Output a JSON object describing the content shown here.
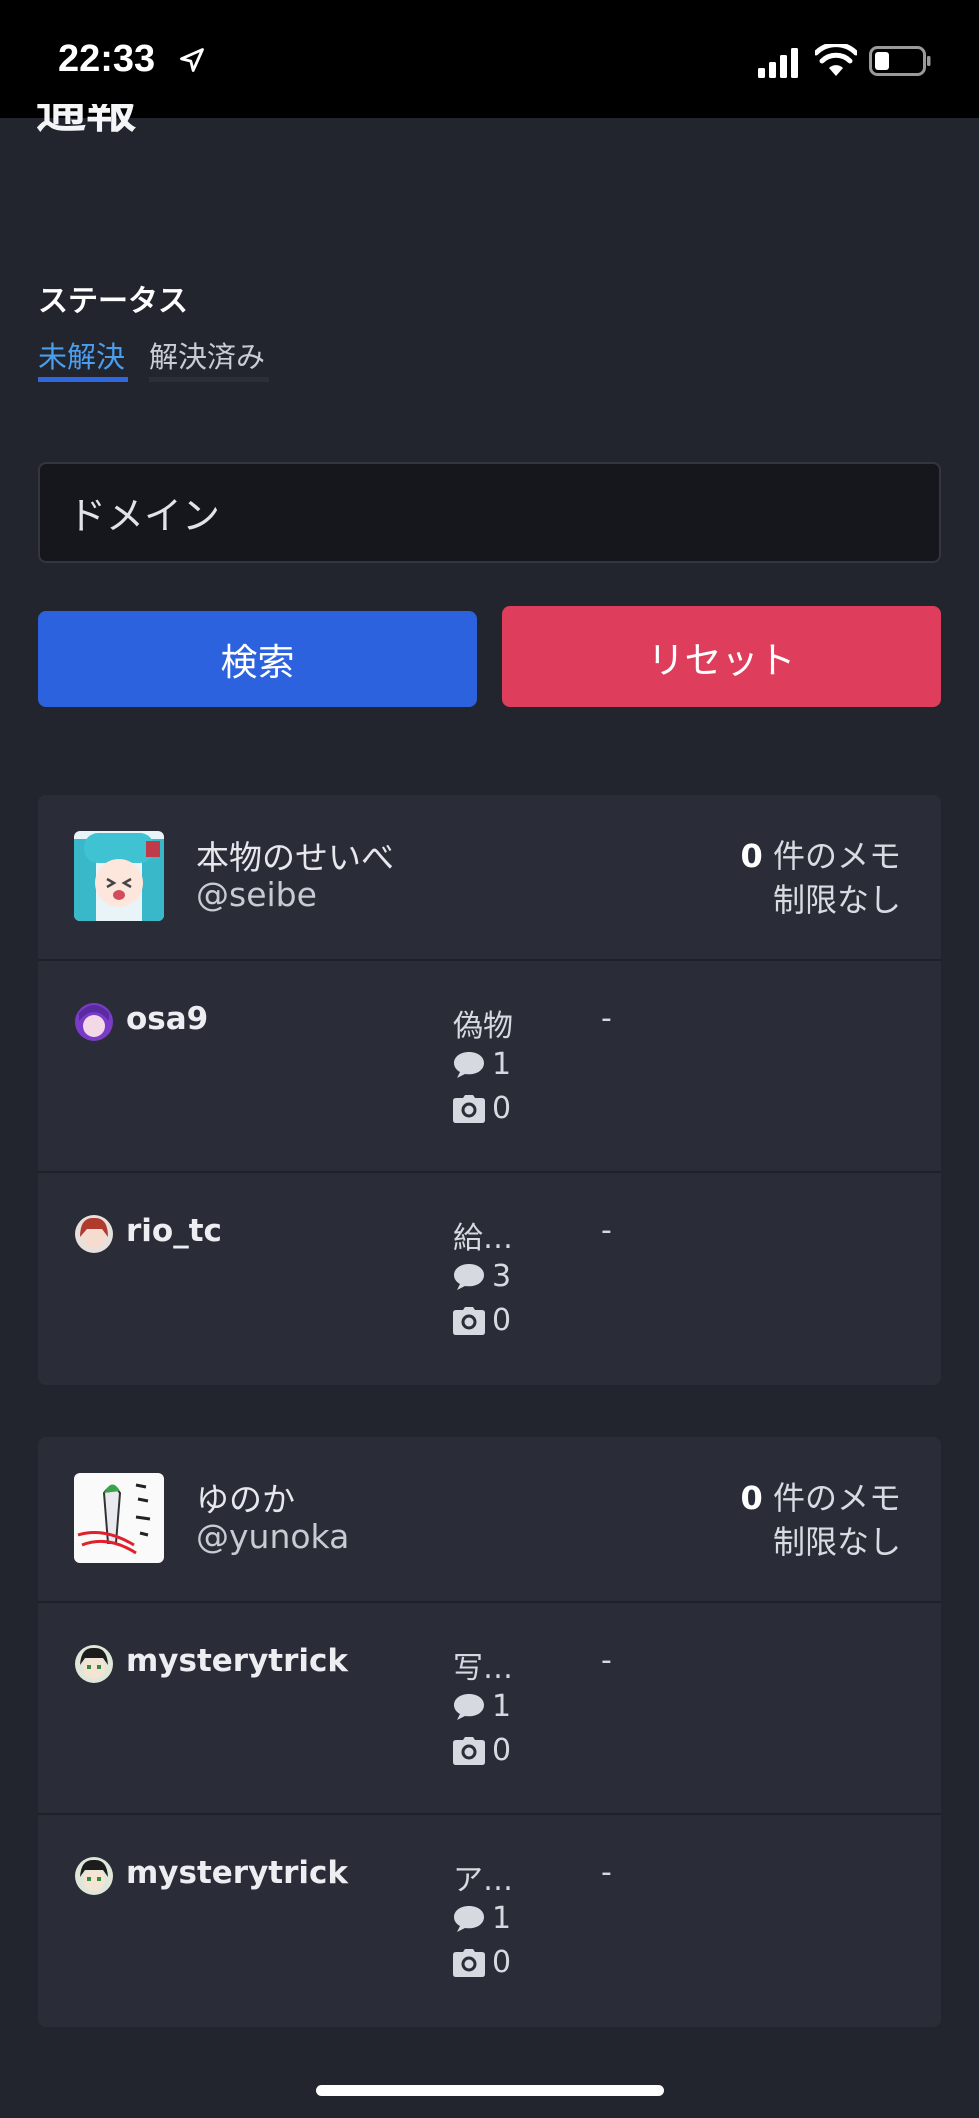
{
  "status_bar": {
    "time": "22:33"
  },
  "page": {
    "title": "通報"
  },
  "filter": {
    "label": "ステータス",
    "tabs": [
      {
        "label": "未解決",
        "active": true
      },
      {
        "label": "解決済み",
        "active": false
      }
    ]
  },
  "search": {
    "placeholder": "ドメイン",
    "search_label": "検索",
    "reset_label": "リセット"
  },
  "colors": {
    "accent": "#2d62df",
    "danger": "#df3d5c",
    "tab_active": "#4b9ded"
  },
  "reports": [
    {
      "target": {
        "name": "本物のせいべ",
        "handle": "@seibe",
        "memo_count": "0",
        "memo_suffix": "件のメモ",
        "limit": "制限なし"
      },
      "items": [
        {
          "reporter": "osa9",
          "reason": "偽物",
          "comments": "1",
          "photos": "0",
          "status": "-"
        },
        {
          "reporter": "rio_tc",
          "reason": "給…",
          "comments": "3",
          "photos": "0",
          "status": "-"
        }
      ]
    },
    {
      "target": {
        "name": "ゆのか",
        "handle": "@yunoka",
        "memo_count": "0",
        "memo_suffix": "件のメモ",
        "limit": "制限なし"
      },
      "items": [
        {
          "reporter": "mysterytrick",
          "reason": "写…",
          "comments": "1",
          "photos": "0",
          "status": "-"
        },
        {
          "reporter": "mysterytrick",
          "reason": "ア…",
          "comments": "1",
          "photos": "0",
          "status": "-"
        }
      ]
    }
  ]
}
